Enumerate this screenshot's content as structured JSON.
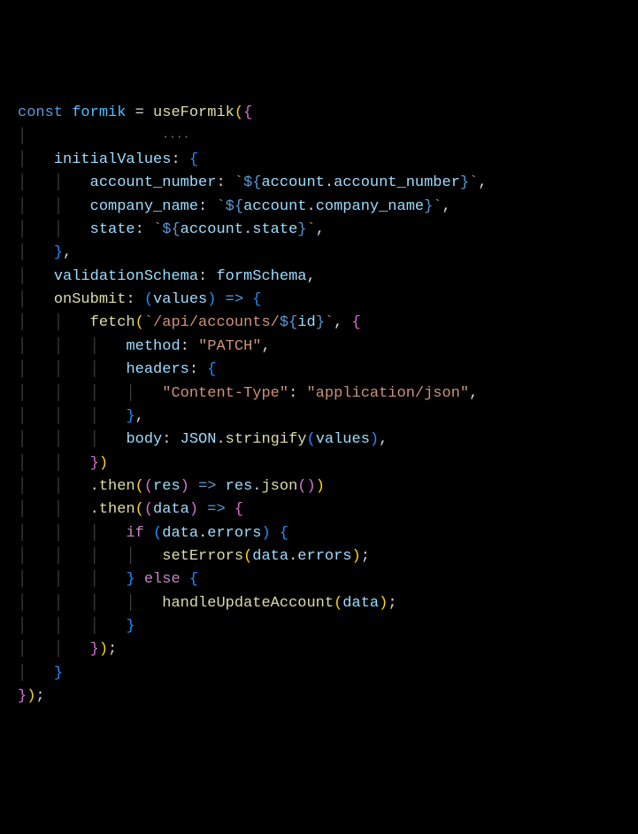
{
  "tokens": {
    "l1": {
      "const": "const",
      "formik": "formik",
      "eq": "=",
      "useFormik": "useFormik",
      "p1": "(",
      "b1": "{"
    },
    "dots": "····",
    "l2": {
      "initialValues": "initialValues",
      "colon": ":",
      "b": "{"
    },
    "l3": {
      "account_number": "account_number",
      "colon": ":",
      "tick1": "`",
      "d1": "${",
      "account": "account",
      "dot": ".",
      "prop": "account_number",
      "d2": "}",
      "tick2": "`",
      "comma": ","
    },
    "l4": {
      "company_name": "company_name",
      "colon": ":",
      "tick1": "`",
      "d1": "${",
      "account": "account",
      "dot": ".",
      "prop": "company_name",
      "d2": "}",
      "tick2": "`",
      "comma": ","
    },
    "l5": {
      "state": "state",
      "colon": ":",
      "tick1": "`",
      "d1": "${",
      "account": "account",
      "dot": ".",
      "prop": "state",
      "d2": "}",
      "tick2": "`",
      "comma": ","
    },
    "l6": {
      "b": "}",
      "comma": ","
    },
    "l7": {
      "validationSchema": "validationSchema",
      "colon": ":",
      "formSchema": "formSchema",
      "comma": ","
    },
    "l8": {
      "onSubmit": "onSubmit",
      "colon": ":",
      "p1": "(",
      "values": "values",
      "p2": ")",
      "arrow": "=>",
      "b": "{"
    },
    "l9": {
      "fetch": "fetch",
      "p1": "(",
      "tick1": "`",
      "path": "/api/accounts/",
      "d1": "${",
      "id": "id",
      "d2": "}",
      "tick2": "`",
      "comma": ",",
      "b": "{"
    },
    "l10": {
      "method": "method",
      "colon": ":",
      "val": "\"PATCH\"",
      "comma": ","
    },
    "l11": {
      "headers": "headers",
      "colon": ":",
      "b": "{"
    },
    "l12": {
      "ct": "\"Content-Type\"",
      "colon": ":",
      "val": "\"application/json\"",
      "comma": ","
    },
    "l13": {
      "b": "}",
      "comma": ","
    },
    "l14": {
      "body": "body",
      "colon": ":",
      "json": "JSON",
      "dot": ".",
      "stringify": "stringify",
      "p1": "(",
      "values": "values",
      "p2": ")",
      "comma": ","
    },
    "l15": {
      "b": "}",
      "p": ")"
    },
    "l16": {
      "dot": ".",
      "then": "then",
      "p1": "(",
      "p2": "(",
      "res": "res",
      "p3": ")",
      "arrow": "=>",
      "res2": "res",
      "dot2": ".",
      "json": "json",
      "p4": "(",
      "p5": ")",
      "p6": ")"
    },
    "l17": {
      "dot": ".",
      "then": "then",
      "p1": "(",
      "p2": "(",
      "data": "data",
      "p3": ")",
      "arrow": "=>",
      "b": "{"
    },
    "l18": {
      "if": "if",
      "p1": "(",
      "data": "data",
      "dot": ".",
      "errors": "errors",
      "p2": ")",
      "b": "{"
    },
    "l19": {
      "setErrors": "setErrors",
      "p1": "(",
      "data": "data",
      "dot": ".",
      "errors": "errors",
      "p2": ")",
      "semi": ";"
    },
    "l20": {
      "b": "}",
      "else": "else",
      "b2": "{"
    },
    "l21": {
      "handleUpdateAccount": "handleUpdateAccount",
      "p1": "(",
      "data": "data",
      "p2": ")",
      "semi": ";"
    },
    "l22": {
      "b": "}"
    },
    "l23": {
      "b": "}",
      "p": ")",
      "semi": ";"
    },
    "l24": {
      "b": "}"
    },
    "l25": {
      "b": "}",
      "p": ")",
      "semi": ";"
    }
  },
  "chart_data": null
}
